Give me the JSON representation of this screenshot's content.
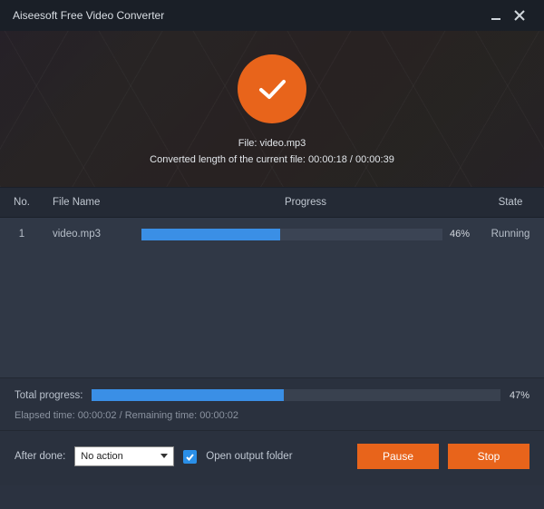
{
  "title": "Aiseesoft Free Video Converter",
  "hero": {
    "file_line": "File: video.mp3",
    "progress_line": "Converted length of the current file: 00:00:18 / 00:00:39"
  },
  "table": {
    "headers": {
      "no": "No.",
      "name": "File Name",
      "progress": "Progress",
      "state": "State"
    },
    "rows": [
      {
        "no": "1",
        "name": "video.mp3",
        "percent": 46,
        "percent_label": "46%",
        "state": "Running"
      }
    ]
  },
  "total": {
    "label": "Total progress:",
    "percent": 47,
    "percent_label": "47%",
    "times": "Elapsed time: 00:00:02 / Remaining time: 00:00:02"
  },
  "actions": {
    "after_done_label": "After done:",
    "after_done_value": "No action",
    "open_output_label": "Open output folder",
    "open_output_checked": true,
    "pause": "Pause",
    "stop": "Stop"
  },
  "colors": {
    "accent": "#e8641b",
    "progress": "#3a8fe6"
  }
}
